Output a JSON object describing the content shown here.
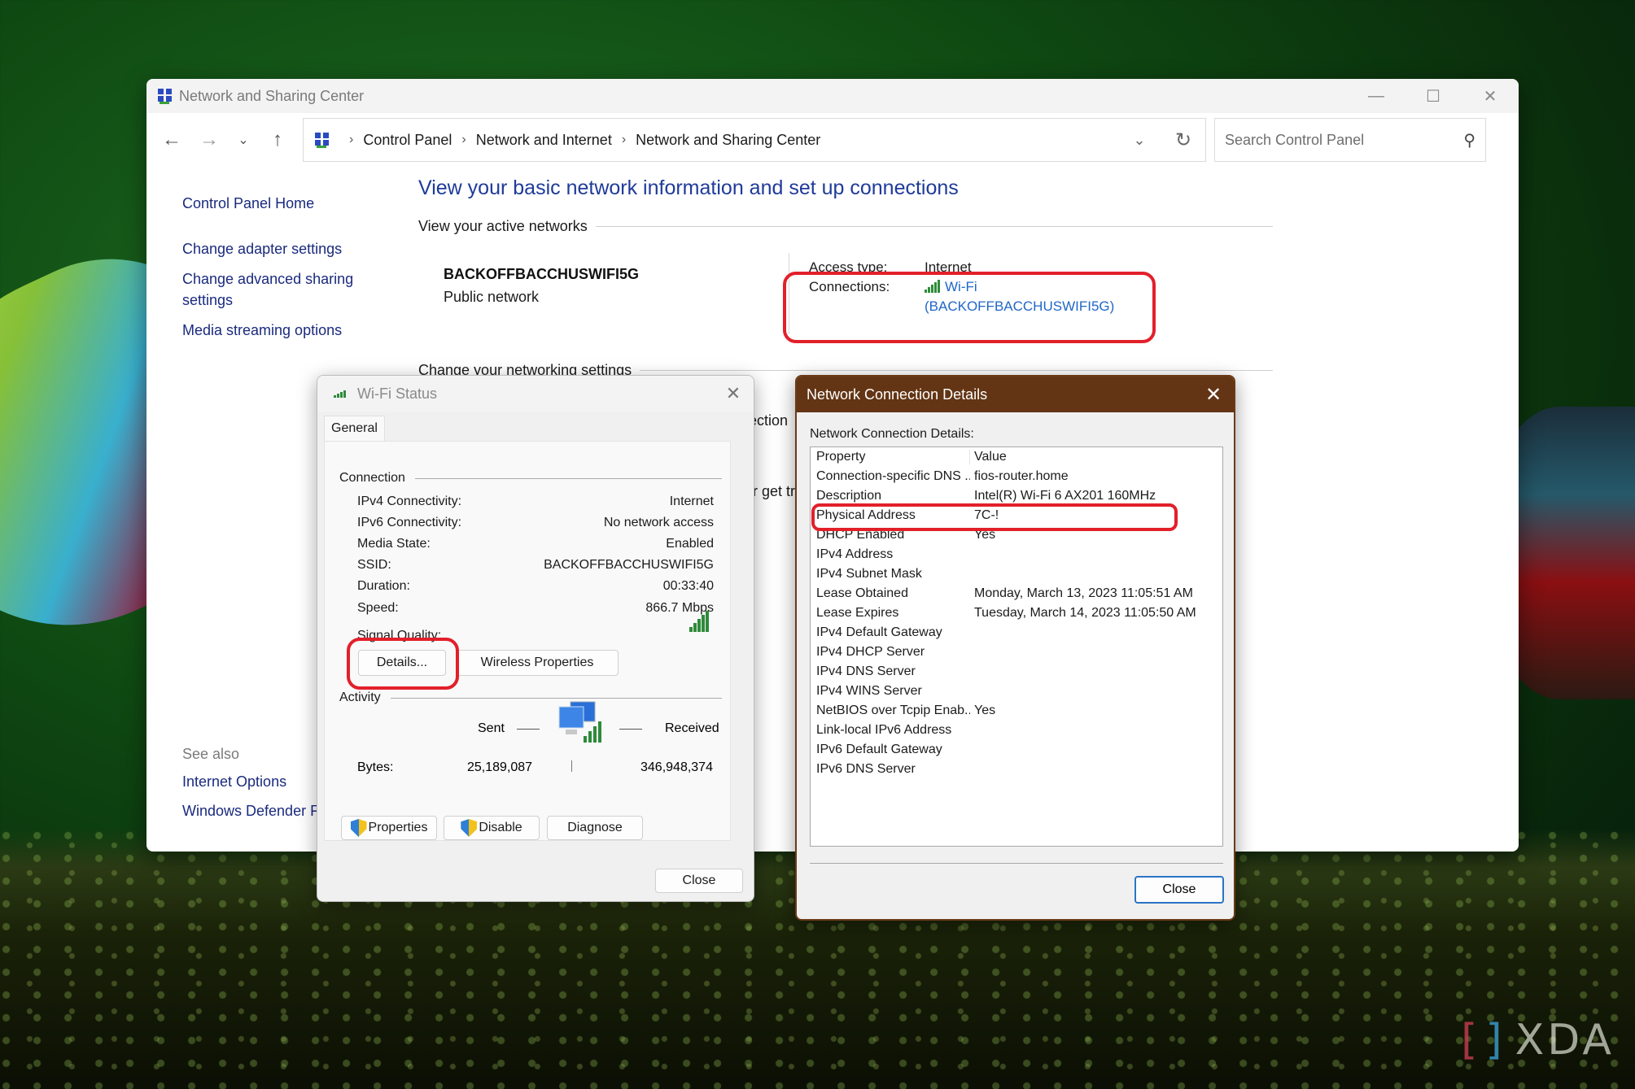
{
  "main_window": {
    "title": "Network and Sharing Center",
    "controls": {
      "minimize": "—",
      "maximize": "☐",
      "close": "✕"
    },
    "nav": {
      "back": "←",
      "forward": "→",
      "recent": "⌄",
      "up": "↑"
    },
    "breadcrumb": [
      "Control Panel",
      "Network and Internet",
      "Network and Sharing Center"
    ],
    "search": {
      "placeholder": "Search Control Panel",
      "value": ""
    },
    "sidebar": {
      "home": "Control Panel Home",
      "links": [
        "Change adapter settings",
        "Change advanced sharing settings",
        "Media streaming options"
      ],
      "see_also_header": "See also",
      "see_also": [
        "Internet Options",
        "Windows Defender Firewall"
      ]
    },
    "content": {
      "title": "View your basic network information and set up connections",
      "active_networks_header": "View your active networks",
      "network_name": "BACKOFFBACCHUSWIFI5G",
      "network_type": "Public network",
      "access_type_label": "Access type:",
      "access_type_value": "Internet",
      "connections_label": "Connections:",
      "connection_link_line1": "Wi-Fi",
      "connection_link_line2": "(BACKOFFBACCHUSWIFI5G)",
      "change_settings_header": "Change your networking settings",
      "peek_text_1": "ection",
      "peek_text_2": "r get tr"
    }
  },
  "wifi_status": {
    "title": "Wi-Fi Status",
    "tab": "General",
    "connection_header": "Connection",
    "rows": [
      {
        "label": "IPv4 Connectivity:",
        "value": "Internet"
      },
      {
        "label": "IPv6 Connectivity:",
        "value": "No network access"
      },
      {
        "label": "Media State:",
        "value": "Enabled"
      },
      {
        "label": "SSID:",
        "value": "BACKOFFBACCHUSWIFI5G"
      },
      {
        "label": "Duration:",
        "value": "00:33:40"
      },
      {
        "label": "Speed:",
        "value": "866.7 Mbps"
      }
    ],
    "signal_label": "Signal Quality:",
    "signal_bars": 5,
    "signal_bars_max": 5,
    "details_button": "Details...",
    "wireless_properties_button": "Wireless Properties",
    "activity_header": "Activity",
    "sent_label": "Sent",
    "received_label": "Received",
    "bytes_label": "Bytes:",
    "bytes_sent": "25,189,087",
    "bytes_received": "346,948,374",
    "properties_button": "Properties",
    "disable_button": "Disable",
    "diagnose_button": "Diagnose",
    "close_button": "Close",
    "close_icon": "✕"
  },
  "connection_details": {
    "title": "Network Connection Details",
    "close_icon": "✕",
    "label": "Network Connection Details:",
    "columns": [
      "Property",
      "Value"
    ],
    "rows": [
      {
        "property": "Connection-specific DNS ...",
        "value": "fios-router.home"
      },
      {
        "property": "Description",
        "value": "Intel(R) Wi-Fi 6 AX201 160MHz"
      },
      {
        "property": "Physical Address",
        "value": "7C-!"
      },
      {
        "property": "DHCP Enabled",
        "value": "Yes"
      },
      {
        "property": "IPv4 Address",
        "value": ""
      },
      {
        "property": "IPv4 Subnet Mask",
        "value": ""
      },
      {
        "property": "Lease Obtained",
        "value": "Monday, March 13, 2023 11:05:51 AM"
      },
      {
        "property": "Lease Expires",
        "value": "Tuesday, March 14, 2023 11:05:50 AM"
      },
      {
        "property": "IPv4 Default Gateway",
        "value": ""
      },
      {
        "property": "IPv4 DHCP Server",
        "value": ""
      },
      {
        "property": "IPv4 DNS Server",
        "value": ""
      },
      {
        "property": "IPv4 WINS Server",
        "value": ""
      },
      {
        "property": "NetBIOS over Tcpip Enab...",
        "value": "Yes"
      },
      {
        "property": "Link-local IPv6 Address",
        "value": ""
      },
      {
        "property": "IPv6 Default Gateway",
        "value": ""
      },
      {
        "property": "IPv6 DNS Server",
        "value": ""
      }
    ],
    "close_button": "Close"
  },
  "watermark": {
    "text": "XDA"
  },
  "colors": {
    "accent_link": "#2067c8",
    "title_blue": "#1f3b9a",
    "highlight_red": "#e2202a",
    "dialog_titlebar": "#633514"
  }
}
